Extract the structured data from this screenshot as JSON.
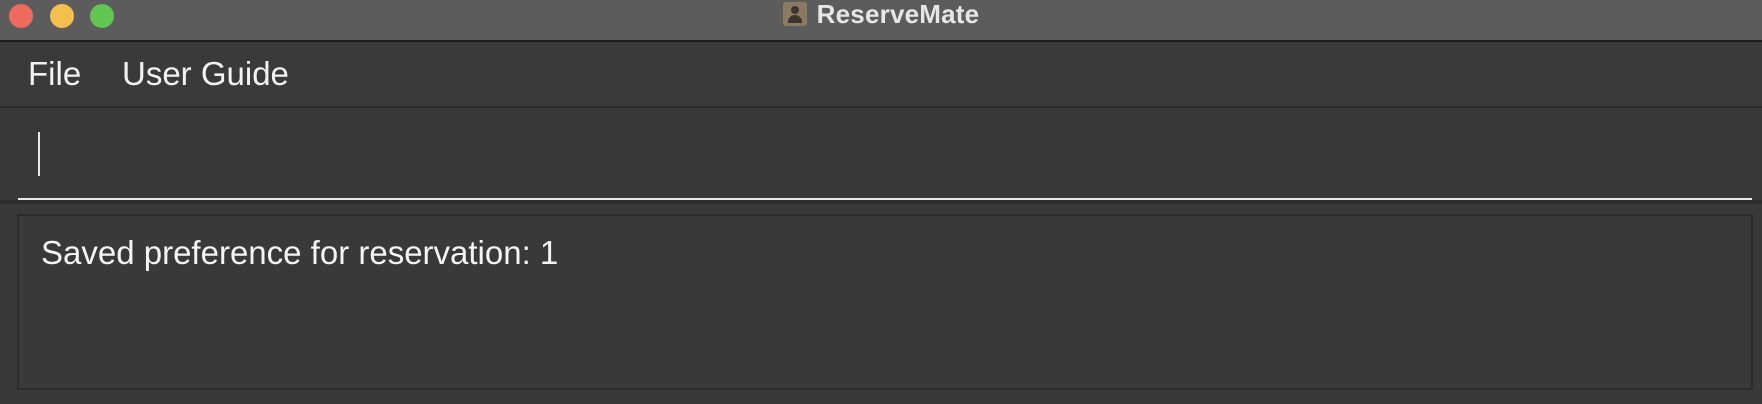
{
  "window": {
    "title": "ReserveMate",
    "app_icon": "contact-book-icon",
    "controls": [
      "close",
      "minimize",
      "zoom"
    ]
  },
  "menubar": {
    "items": [
      {
        "label": "File"
      },
      {
        "label": "User Guide"
      }
    ]
  },
  "command_box": {
    "value": "",
    "placeholder": ""
  },
  "result_display": {
    "text": "Saved preference for reservation: 1"
  },
  "colors": {
    "titlebar": "#5c5c5c",
    "background": "#393939",
    "close": "#ee6a5f",
    "minimize": "#f5bf4f",
    "zoom": "#61c554",
    "text": "#f2f2f2"
  }
}
